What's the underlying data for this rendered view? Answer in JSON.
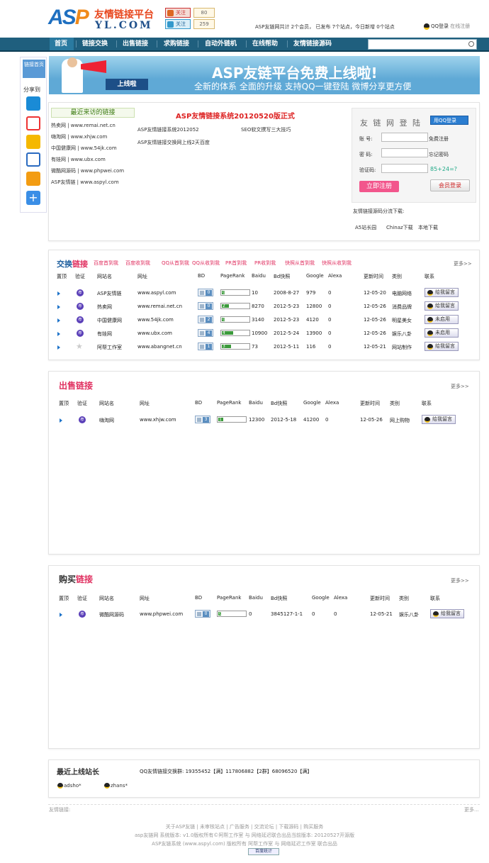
{
  "header": {
    "logo_latin": "ASP",
    "logo_title": "友情链接平台",
    "logo_domain": "YL.COM",
    "follow1": "关注",
    "follow2": "关注",
    "count1": "80",
    "count2": "259",
    "stats": "ASP友链网共计 2个会员， 已发布 7个站点，今日新增 0个站点",
    "qq_login": "QQ登录",
    "register": "在线注册"
  },
  "nav": {
    "items": [
      "首页",
      "链接交换",
      "出售链接",
      "求购链接",
      "自动外链机",
      "在线帮助",
      "友情链接源码"
    ],
    "active": 0
  },
  "share": {
    "home": "链接首页",
    "label": "分享到",
    "icons": [
      "qzone-icon",
      "weibo-icon",
      "star-icon",
      "renren-icon",
      "qq-icon",
      "plus-icon"
    ]
  },
  "banner": {
    "title": "ASP友链平台免费上线啦!",
    "subtitle": "全新的体系  全面的升级  支持QQ一键登陆 微博分享更方便",
    "tag": "上线啦"
  },
  "recent": {
    "title": "最近来访的链接",
    "items": [
      "热卖网 | www.remai.net.cn",
      "嗨淘网 | www.xhjw.com",
      "中国健康网 | www.54jk.com",
      "有娃网 | www.ubx.com",
      "微酷网源码 | www.phpwei.com",
      "ASP友情链 | www.aspyl.com"
    ]
  },
  "announce": {
    "title": "ASP友情链接系统20120520版正式",
    "items": [
      "ASP友情链接系统2012052",
      "SEO软文撰写三大技巧",
      "ASP友情链接交换网上线2天百度"
    ]
  },
  "login": {
    "title": "友 链 网 登 陆",
    "qq_button": "用QQ登录",
    "labels": [
      "账  号:",
      "密  码:",
      "验证码:"
    ],
    "tips": [
      "免费注册",
      "忘记密码"
    ],
    "captcha": "85+24=?",
    "register_btn": "立即注册",
    "login_btn": "会员登录"
  },
  "download": {
    "title": "友情链接源码分流下载:",
    "links": [
      "A5站长园",
      "Chinaz下载",
      "本地下载"
    ]
  },
  "exchange": {
    "title_a": "交换",
    "title_b": "链接",
    "filters": [
      "百度首到我",
      "百度收到我",
      "QQ从首到我",
      "QQ从收到我",
      "PR首到我",
      "PR收到我",
      "快照从首到我",
      "快照从收到我"
    ],
    "more": "更多>>",
    "headers": [
      "置顶",
      "验证",
      "网站名",
      "网址",
      "BD",
      "PageRank",
      "Baidu",
      "Bd快照",
      "Google",
      "Alexa",
      "更新时间",
      "类别",
      "联系"
    ],
    "rows": [
      {
        "name": "ASP友情链",
        "url": "www.aspyl.com",
        "bd": "0",
        "pr": "0",
        "baidu": "10",
        "snap": "2008-8-27",
        "google": "979",
        "alexa": "0",
        "date": "12-05-20",
        "cat": "电脑网络",
        "contact": "给我留言",
        "verified": true
      },
      {
        "name": "热卖网",
        "url": "www.remai.net.cn",
        "bd": "0",
        "pr": "2",
        "baidu": "8270",
        "snap": "2012-5-23",
        "google": "12800",
        "alexa": "0",
        "date": "12-05-26",
        "cat": "消费品牌",
        "contact": "给我留言",
        "verified": true
      },
      {
        "name": "中国健康网",
        "url": "www.54jk.com",
        "bd": "2",
        "pr": "0",
        "baidu": "3140",
        "snap": "2012-5-23",
        "google": "4120",
        "alexa": "0",
        "date": "12-05-26",
        "cat": "明星美女",
        "contact": "未启用",
        "verified": true
      },
      {
        "name": "有娃网",
        "url": "www.ubx.com",
        "bd": "4",
        "pr": "4",
        "baidu": "10900",
        "snap": "2012-5-24",
        "google": "13900",
        "alexa": "0",
        "date": "12-05-26",
        "cat": "娱乐八卦",
        "contact": "未启用",
        "verified": true
      },
      {
        "name": "阿帮工作室",
        "url": "www.abangnet.cn",
        "bd": "1",
        "pr": "3",
        "baidu": "73",
        "snap": "2012-5-11",
        "google": "116",
        "alexa": "0",
        "date": "12-05-21",
        "cat": "网站制作",
        "contact": "给我留言",
        "verified": false
      }
    ]
  },
  "sell": {
    "title": "出售链接",
    "more": "更多>>",
    "headers": [
      "置顶",
      "验证",
      "网站名",
      "网址",
      "BD",
      "PageRank",
      "Baidu",
      "Bd快照",
      "Google",
      "Alexa",
      "更新时间",
      "类别",
      "联系"
    ],
    "rows": [
      {
        "name": "嗨淘网",
        "url": "www.xhjw.com",
        "bd": "3",
        "pr": "1",
        "baidu": "12300",
        "snap": "2012-5-18",
        "google": "41200",
        "alexa": "0",
        "date": "12-05-26",
        "cat": "网上购物",
        "contact": "给我留言"
      }
    ]
  },
  "buy": {
    "title_a": "购买",
    "title_b": "链接",
    "more": "更多>>",
    "headers": [
      "置顶",
      "验证",
      "网站名",
      "网址",
      "BD",
      "PageRank",
      "Baidu",
      "Bd快照",
      "Google",
      "Alexa",
      "更新时间",
      "类别",
      "联系"
    ],
    "rows": [
      {
        "name": "微酷网源码",
        "url": "www.phpwei.com",
        "bd": "0",
        "pr": "0",
        "baidu": "0",
        "snap": "3845127-1-1",
        "google": "0",
        "alexa": "0",
        "date": "12-05-21",
        "cat": "娱乐八卦",
        "contact": "给我留言"
      }
    ]
  },
  "owners": {
    "title": "最近上线站长",
    "qq_groups": "QQ友情链接交换群: 19355452【满】117806882【2群】68096520【满】",
    "users": [
      "adsho*",
      "zhans*"
    ]
  },
  "footer": {
    "friend_label": "友情链接:",
    "more": "更多...",
    "links": "关于ASP友链 | 未审核站点 | 广告服务 | 交流论坛 | 下载源码 | 购买服务",
    "line2": "asp友链网   系统版本: v1.0版权所有©阿帮工作室 与 网络延迟联合出品当前版本: 20120527开源版",
    "line3": "ASP友链系统 (www.aspyl.com) 版权所有 阿帮工作室 与 网络延迟工作室 联合出品",
    "stat": "百度统计"
  }
}
